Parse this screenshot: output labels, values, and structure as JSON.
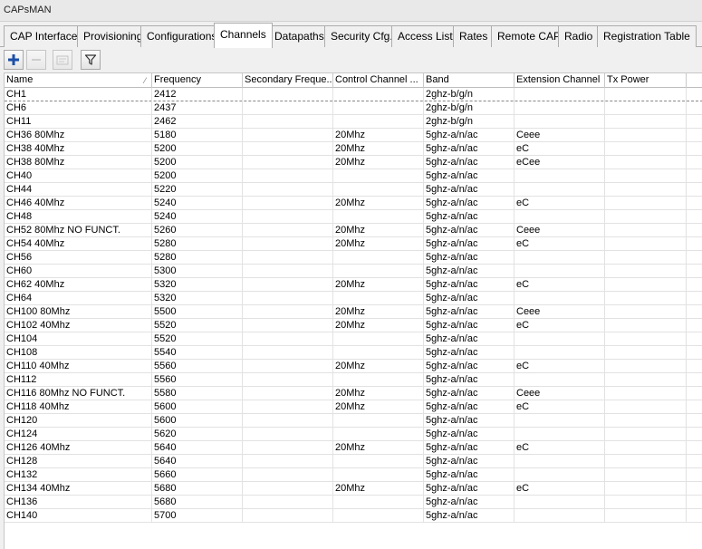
{
  "window": {
    "title": "CAPsMAN"
  },
  "tabs": [
    {
      "label": "CAP Interface",
      "active": false
    },
    {
      "label": "Provisioning",
      "active": false
    },
    {
      "label": "Configurations",
      "active": false
    },
    {
      "label": "Channels",
      "active": true
    },
    {
      "label": "Datapaths",
      "active": false
    },
    {
      "label": "Security Cfg.",
      "active": false
    },
    {
      "label": "Access List",
      "active": false
    },
    {
      "label": "Rates",
      "active": false
    },
    {
      "label": "Remote CAP",
      "active": false
    },
    {
      "label": "Radio",
      "active": false
    },
    {
      "label": "Registration Table",
      "active": false
    }
  ],
  "toolbar": {
    "buttons": [
      {
        "icon": "plus-icon",
        "enabled": true
      },
      {
        "icon": "minus-icon",
        "enabled": false
      },
      {
        "icon": "comment-icon",
        "enabled": false
      },
      {
        "icon": "filter-icon",
        "enabled": true
      }
    ],
    "accent_color": "#1b4fa8"
  },
  "table": {
    "columns": [
      "Name",
      "Frequency",
      "Secondary Freque...",
      "Control Channel ...",
      "Band",
      "Extension Channel",
      "Tx Power"
    ],
    "rows": [
      [
        "CH1",
        "2412",
        "",
        "",
        "2ghz-b/g/n",
        "",
        ""
      ],
      [
        "CH6",
        "2437",
        "",
        "",
        "2ghz-b/g/n",
        "",
        ""
      ],
      [
        "CH11",
        "2462",
        "",
        "",
        "2ghz-b/g/n",
        "",
        ""
      ],
      [
        "CH36 80Mhz",
        "5180",
        "",
        "20Mhz",
        "5ghz-a/n/ac",
        "Ceee",
        ""
      ],
      [
        "CH38 40Mhz",
        "5200",
        "",
        "20Mhz",
        "5ghz-a/n/ac",
        "eC",
        ""
      ],
      [
        "CH38 80Mhz",
        "5200",
        "",
        "20Mhz",
        "5ghz-a/n/ac",
        "eCee",
        ""
      ],
      [
        "CH40",
        "5200",
        "",
        "",
        "5ghz-a/n/ac",
        "",
        ""
      ],
      [
        "CH44",
        "5220",
        "",
        "",
        "5ghz-a/n/ac",
        "",
        ""
      ],
      [
        "CH46 40Mhz",
        "5240",
        "",
        "20Mhz",
        "5ghz-a/n/ac",
        "eC",
        ""
      ],
      [
        "CH48",
        "5240",
        "",
        "",
        "5ghz-a/n/ac",
        "",
        ""
      ],
      [
        "CH52 80Mhz NO FUNCT.",
        "5260",
        "",
        "20Mhz",
        "5ghz-a/n/ac",
        "Ceee",
        ""
      ],
      [
        "CH54 40Mhz",
        "5280",
        "",
        "20Mhz",
        "5ghz-a/n/ac",
        "eC",
        ""
      ],
      [
        "CH56",
        "5280",
        "",
        "",
        "5ghz-a/n/ac",
        "",
        ""
      ],
      [
        "CH60",
        "5300",
        "",
        "",
        "5ghz-a/n/ac",
        "",
        ""
      ],
      [
        "CH62 40Mhz",
        "5320",
        "",
        "20Mhz",
        "5ghz-a/n/ac",
        "eC",
        ""
      ],
      [
        "CH64",
        "5320",
        "",
        "",
        "5ghz-a/n/ac",
        "",
        ""
      ],
      [
        "CH100 80Mhz",
        "5500",
        "",
        "20Mhz",
        "5ghz-a/n/ac",
        "Ceee",
        ""
      ],
      [
        "CH102 40Mhz",
        "5520",
        "",
        "20Mhz",
        "5ghz-a/n/ac",
        "eC",
        ""
      ],
      [
        "CH104",
        "5520",
        "",
        "",
        "5ghz-a/n/ac",
        "",
        ""
      ],
      [
        "CH108",
        "5540",
        "",
        "",
        "5ghz-a/n/ac",
        "",
        ""
      ],
      [
        "CH110 40Mhz",
        "5560",
        "",
        "20Mhz",
        "5ghz-a/n/ac",
        "eC",
        ""
      ],
      [
        "CH112",
        "5560",
        "",
        "",
        "5ghz-a/n/ac",
        "",
        ""
      ],
      [
        "CH116 80Mhz NO FUNCT.",
        "5580",
        "",
        "20Mhz",
        "5ghz-a/n/ac",
        "Ceee",
        ""
      ],
      [
        "CH118 40Mhz",
        "5600",
        "",
        "20Mhz",
        "5ghz-a/n/ac",
        "eC",
        ""
      ],
      [
        "CH120",
        "5600",
        "",
        "",
        "5ghz-a/n/ac",
        "",
        ""
      ],
      [
        "CH124",
        "5620",
        "",
        "",
        "5ghz-a/n/ac",
        "",
        ""
      ],
      [
        "CH126 40Mhz",
        "5640",
        "",
        "20Mhz",
        "5ghz-a/n/ac",
        "eC",
        ""
      ],
      [
        "CH128",
        "5640",
        "",
        "",
        "5ghz-a/n/ac",
        "",
        ""
      ],
      [
        "CH132",
        "5660",
        "",
        "",
        "5ghz-a/n/ac",
        "",
        ""
      ],
      [
        "CH134 40Mhz",
        "5680",
        "",
        "20Mhz",
        "5ghz-a/n/ac",
        "eC",
        ""
      ],
      [
        "CH136",
        "5680",
        "",
        "",
        "5ghz-a/n/ac",
        "",
        ""
      ],
      [
        "CH140",
        "5700",
        "",
        "",
        "5ghz-a/n/ac",
        "",
        ""
      ]
    ],
    "selected_row": 0,
    "sort_column": 0
  }
}
